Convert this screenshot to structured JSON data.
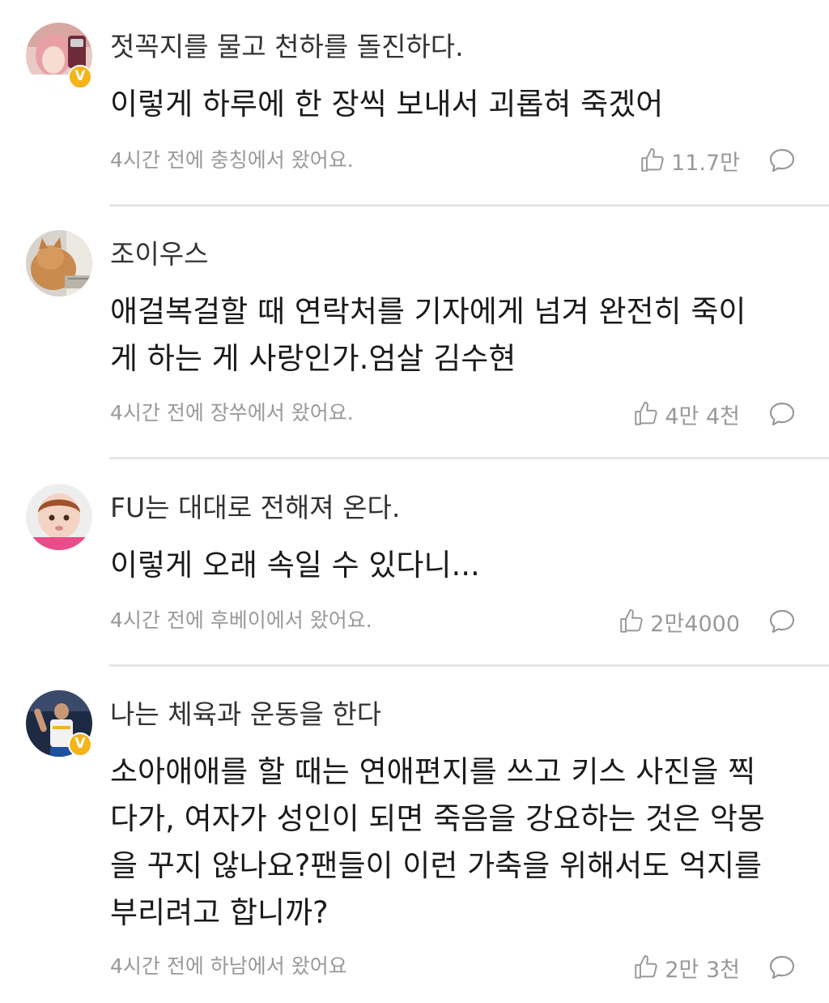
{
  "comments": [
    {
      "username": "젓꼭지를 물고 천하를 돌진하다.",
      "verified": true,
      "verified_glyph": "V",
      "avatar_icon": "avatar-pink-hair-girl",
      "content_lines": [
        "이렇게 하루에 한 장씩 보내서 괴롭혀 죽겠어"
      ],
      "meta": "4시간 전에 충칭에서 왔어요.",
      "likes": "11.7만"
    },
    {
      "username": "조이우스",
      "verified": false,
      "avatar_icon": "avatar-orange-cat",
      "content_lines": [
        "애걸복걸할 때 연락처를 기자에게 넘겨 완전히 죽이",
        "게 하는 게 사랑인가.엄살 김수현"
      ],
      "meta": "4시간 전에 장쑤에서 왔어요.",
      "likes": "4만 4천"
    },
    {
      "username": "FU는 대대로 전해져 온다.",
      "verified": false,
      "avatar_icon": "avatar-baby",
      "content_lines": [
        "이렇게 오래 속일 수 있다니..."
      ],
      "meta": "4시간 전에 후베이에서 왔어요.",
      "likes": "2만4000"
    },
    {
      "username": "나는 체육과 운동을 한다",
      "verified": true,
      "verified_glyph": "V",
      "avatar_icon": "avatar-basketball-player",
      "content_lines": [
        "소아애애를 할 때는 연애편지를 쓰고 키스 사진을 찍",
        "다가, 여자가 성인이 되면 죽음을 강요하는 것은 악몽",
        "을 꾸지 않나요?팬들이 이런 가축을 위해서도 억지를",
        "부리려고 합니까?"
      ],
      "meta": "4시간 전에 하남에서 왔어요",
      "likes": "2만 3천"
    }
  ],
  "icons": {
    "like": "thumbs-up-outline-icon",
    "reply": "speech-bubble-outline-icon"
  },
  "colors": {
    "verified_badge": "#f4b41a",
    "meta_text": "#999999",
    "divider": "#e6e6e6"
  }
}
